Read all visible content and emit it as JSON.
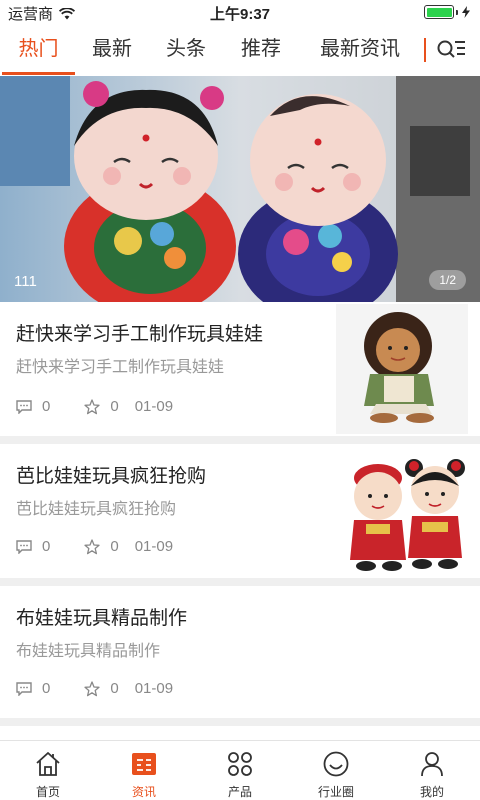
{
  "status_bar": {
    "carrier": "运营商",
    "time": "上午9:37",
    "battery_percent": 100
  },
  "tabs": [
    {
      "label": "热门",
      "active": true
    },
    {
      "label": "最新",
      "active": false
    },
    {
      "label": "头条",
      "active": false
    },
    {
      "label": "推荐",
      "active": false
    },
    {
      "label": "最新资讯",
      "active": false
    }
  ],
  "banner": {
    "caption": "111",
    "indicator": "1/2"
  },
  "news": [
    {
      "title": "赶快来学习手工制作玩具娃娃",
      "summary": "赶快来学习手工制作玩具娃娃",
      "comments": "0",
      "likes": "0",
      "date": "01-09"
    },
    {
      "title": "芭比娃娃玩具疯狂抢购",
      "summary": "芭比娃娃玩具疯狂抢购",
      "comments": "0",
      "likes": "0",
      "date": "01-09"
    },
    {
      "title": "布娃娃玩具精品制作",
      "summary": "布娃娃玩具精品制作",
      "comments": "0",
      "likes": "0",
      "date": "01-09"
    }
  ],
  "bottom_nav": [
    {
      "label": "首页",
      "icon": "home-icon",
      "active": false
    },
    {
      "label": "资讯",
      "icon": "news-icon",
      "active": true
    },
    {
      "label": "产品",
      "icon": "grid-icon",
      "active": false
    },
    {
      "label": "行业圈",
      "icon": "smile-icon",
      "active": false
    },
    {
      "label": "我的",
      "icon": "person-icon",
      "active": false
    }
  ],
  "colors": {
    "accent": "#e8501d",
    "battery": "#2bd24c",
    "separator": "#efefef"
  }
}
